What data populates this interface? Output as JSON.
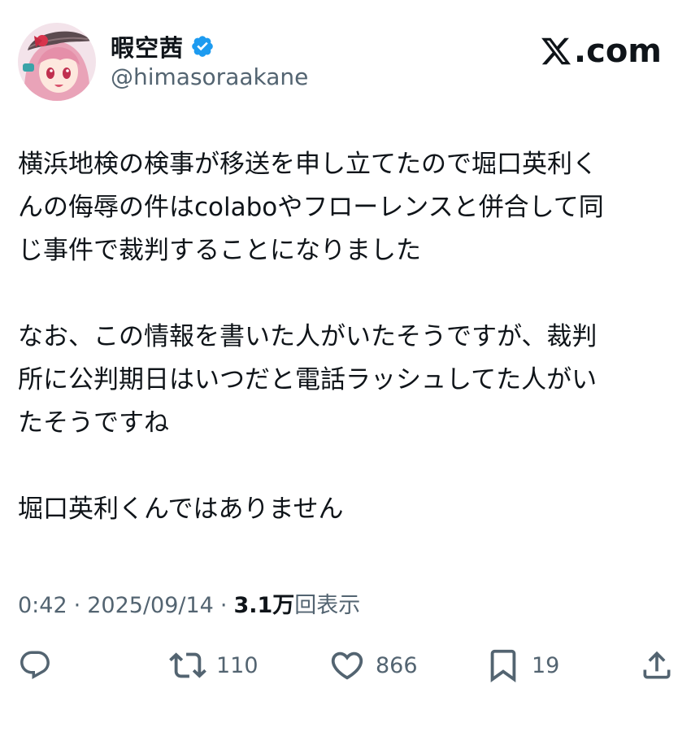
{
  "user": {
    "display_name": "暇空茜",
    "handle": "@himasoraakane",
    "verified": true,
    "verified_color": "#1d9bf0"
  },
  "brand": {
    "label": ".com",
    "full": "X.com"
  },
  "post": {
    "paragraphs": [
      "横浜地検の検事が移送を申し立てたので堀口英利く\nんの侮辱の件はcolaboやフローレンスと併合して同\nじ事件で裁判することになりました",
      "なお、この情報を書いた人がいたそうですが、裁判\n所に公判期日はいつだと電話ラッシュしてた人がい\nたそうですね",
      "堀口英利くんではありません"
    ]
  },
  "meta": {
    "time": "0:42",
    "separator": "·",
    "date": "2025/09/14",
    "views_count": "3.1万",
    "views_label": "回表示"
  },
  "actions": {
    "reply_icon": "reply-icon",
    "retweet_count": "110",
    "like_count": "866",
    "bookmark_count": "19",
    "share_icon": "share-icon"
  }
}
